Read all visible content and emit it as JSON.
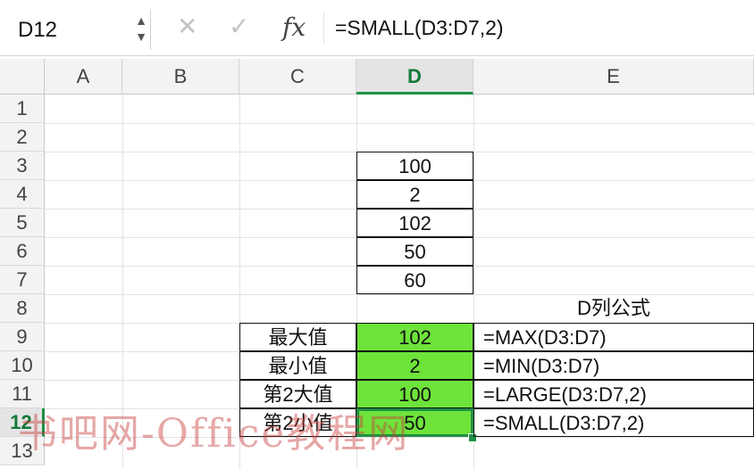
{
  "formula_bar": {
    "name_box": "D12",
    "spin_up": "▲",
    "spin_down": "▼",
    "cancel_glyph": "✕",
    "confirm_glyph": "✓",
    "fx_glyph": "fx",
    "formula": "=SMALL(D3:D7,2)"
  },
  "columns": [
    "A",
    "B",
    "C",
    "D",
    "E"
  ],
  "rows": [
    "1",
    "2",
    "3",
    "4",
    "5",
    "6",
    "7",
    "8",
    "9",
    "10",
    "11",
    "12",
    "13"
  ],
  "active_cell": {
    "column": "D",
    "row": "12"
  },
  "data_cells": {
    "d3": "100",
    "d4": "2",
    "d5": "102",
    "d6": "50",
    "d7": "60"
  },
  "summary": {
    "header_e8": "D列公式",
    "rows": [
      {
        "label": "最大值",
        "value": "102",
        "formula": "=MAX(D3:D7)"
      },
      {
        "label": "最小值",
        "value": "2",
        "formula": "=MIN(D3:D7)"
      },
      {
        "label": "第2大值",
        "value": "100",
        "formula": "=LARGE(D3:D7,2)"
      },
      {
        "label": "第2小值",
        "value": "50",
        "formula": "=SMALL(D3:D7,2)"
      }
    ]
  },
  "watermark": "书吧网-Office教程网",
  "colors": {
    "highlight_green": "#6ee33a",
    "selection_green": "#1f8f45",
    "header_gray": "#f3f3f3"
  }
}
